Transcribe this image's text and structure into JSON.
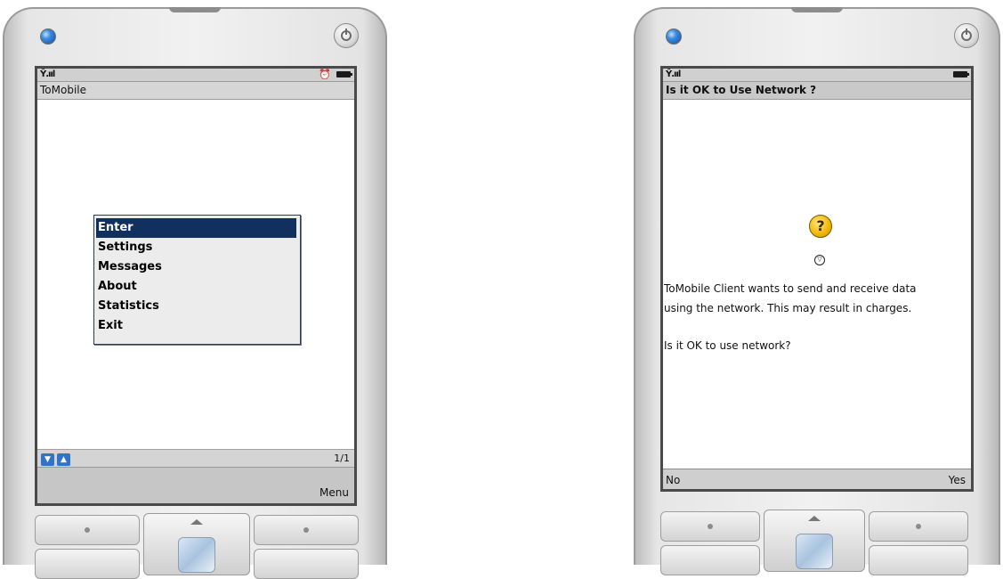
{
  "left_phone": {
    "title": "ToMobile",
    "status": {
      "signal_icon": "signal-icon",
      "signal_glyph": "Ŷ.ııl",
      "alarm_icon": "alarm-icon",
      "alarm_glyph": "⏰",
      "battery_icon": "battery-icon"
    },
    "menu": {
      "items": [
        {
          "label": "Enter",
          "selected": true
        },
        {
          "label": "Settings",
          "selected": false
        },
        {
          "label": "Messages",
          "selected": false
        },
        {
          "label": "About",
          "selected": false
        },
        {
          "label": "Statistics",
          "selected": false
        },
        {
          "label": "Exit",
          "selected": false
        }
      ]
    },
    "scroll": {
      "down_glyph": "▼",
      "up_glyph": "▲",
      "page_indicator": "1/1"
    },
    "softkey_right": "Menu"
  },
  "right_phone": {
    "title": "Is it OK to Use Network ?",
    "status": {
      "signal_icon": "signal-icon",
      "signal_glyph": "Ŷ.ııl",
      "battery_icon": "battery-icon"
    },
    "question_glyph": "?",
    "small_icon_glyph": "▽",
    "message_line1": "ToMobile Client wants to send and receive data",
    "message_line2": "using the network. This may result in charges.",
    "prompt": "Is it OK to use network?",
    "softkey_left": "No",
    "softkey_right": "Yes"
  },
  "colors": {
    "selection": "#11305f",
    "accent_blue": "#2f74c8",
    "question_yellow": "#f2b400"
  }
}
